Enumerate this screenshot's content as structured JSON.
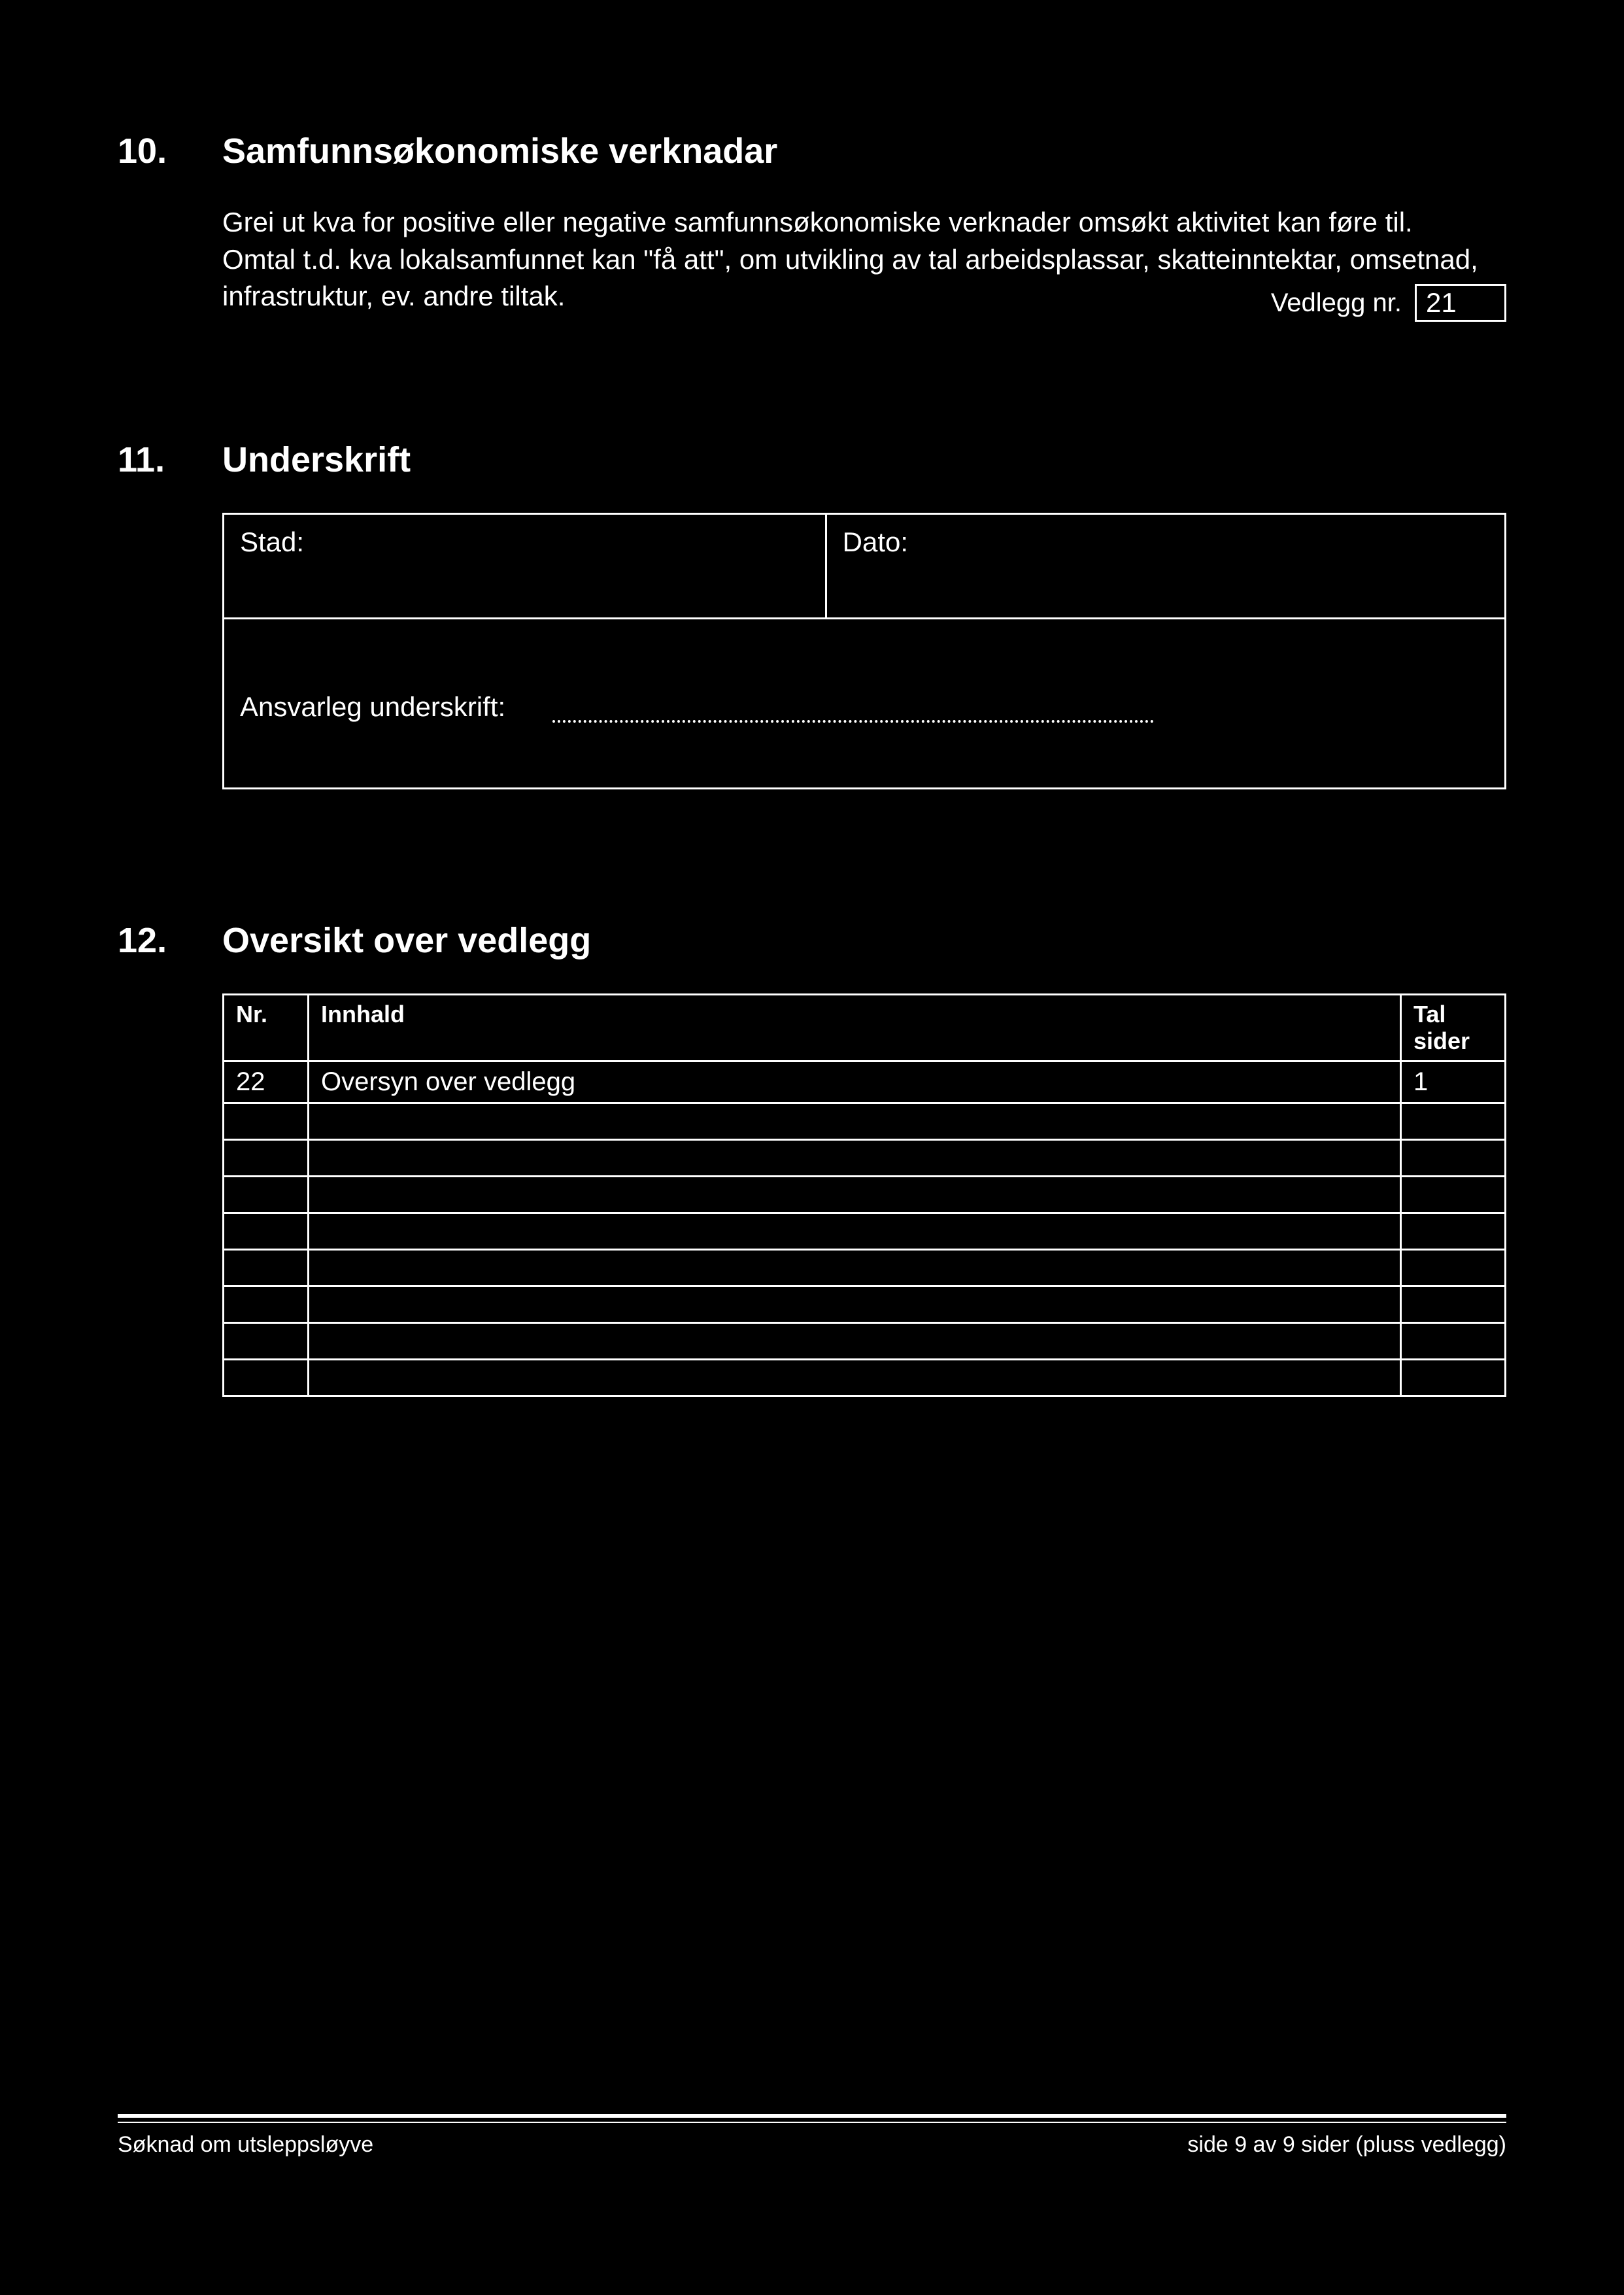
{
  "section10": {
    "number": "10.",
    "title": "Samfunnsøkonomiske verknadar",
    "para1": "Grei ut kva for positive eller negative samfunnsøkonomiske verknader omsøkt aktivitet kan føre til.",
    "para2": "Omtal t.d. kva lokalsamfunnet kan \"få att\", om utvikling av tal arbeidsplassar, skatteinntektar, omsetnad, infrastruktur, ev. andre tiltak.",
    "vedlegg_label": "Vedlegg nr.",
    "vedlegg_value": "21"
  },
  "section11": {
    "number": "11.",
    "title": "Underskrift",
    "stad_label": "Stad:",
    "dato_label": "Dato:",
    "ansvarleg_label": "Ansvarleg underskrift:"
  },
  "section12": {
    "number": "12.",
    "title": "Oversikt over vedlegg",
    "headers": {
      "nr": "Nr.",
      "innhald": "Innhald",
      "tal_sider": "Tal sider"
    },
    "rows": [
      {
        "nr": "22",
        "innhald": "Oversyn over vedlegg",
        "tal_sider": "1"
      },
      {
        "nr": "",
        "innhald": "",
        "tal_sider": ""
      },
      {
        "nr": "",
        "innhald": "",
        "tal_sider": ""
      },
      {
        "nr": "",
        "innhald": "",
        "tal_sider": ""
      },
      {
        "nr": "",
        "innhald": "",
        "tal_sider": ""
      },
      {
        "nr": "",
        "innhald": "",
        "tal_sider": ""
      },
      {
        "nr": "",
        "innhald": "",
        "tal_sider": ""
      },
      {
        "nr": "",
        "innhald": "",
        "tal_sider": ""
      },
      {
        "nr": "",
        "innhald": "",
        "tal_sider": ""
      }
    ]
  },
  "footer": {
    "left": "Søknad om utsleppsløyve",
    "right": "side 9 av 9 sider (pluss vedlegg)"
  }
}
